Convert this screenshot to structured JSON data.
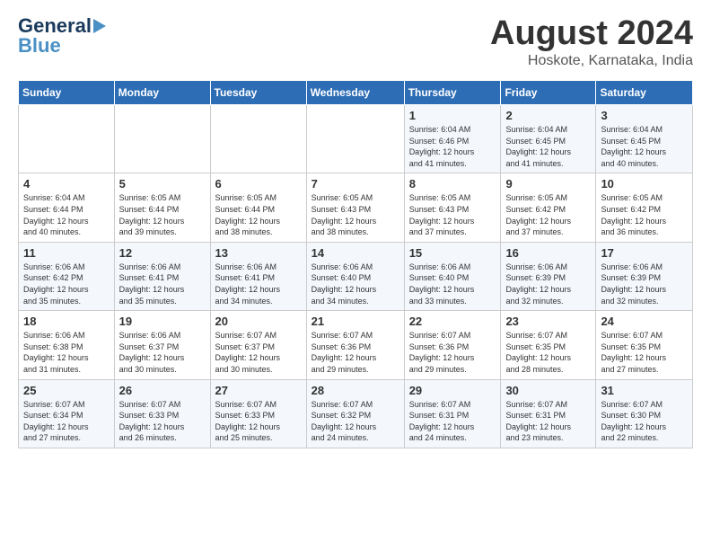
{
  "logo": {
    "line1": "General",
    "line2": "Blue"
  },
  "title": "August 2024",
  "subtitle": "Hoskote, Karnataka, India",
  "headers": [
    "Sunday",
    "Monday",
    "Tuesday",
    "Wednesday",
    "Thursday",
    "Friday",
    "Saturday"
  ],
  "weeks": [
    [
      {
        "day": "",
        "info": ""
      },
      {
        "day": "",
        "info": ""
      },
      {
        "day": "",
        "info": ""
      },
      {
        "day": "",
        "info": ""
      },
      {
        "day": "1",
        "info": "Sunrise: 6:04 AM\nSunset: 6:46 PM\nDaylight: 12 hours\nand 41 minutes."
      },
      {
        "day": "2",
        "info": "Sunrise: 6:04 AM\nSunset: 6:45 PM\nDaylight: 12 hours\nand 41 minutes."
      },
      {
        "day": "3",
        "info": "Sunrise: 6:04 AM\nSunset: 6:45 PM\nDaylight: 12 hours\nand 40 minutes."
      }
    ],
    [
      {
        "day": "4",
        "info": "Sunrise: 6:04 AM\nSunset: 6:44 PM\nDaylight: 12 hours\nand 40 minutes."
      },
      {
        "day": "5",
        "info": "Sunrise: 6:05 AM\nSunset: 6:44 PM\nDaylight: 12 hours\nand 39 minutes."
      },
      {
        "day": "6",
        "info": "Sunrise: 6:05 AM\nSunset: 6:44 PM\nDaylight: 12 hours\nand 38 minutes."
      },
      {
        "day": "7",
        "info": "Sunrise: 6:05 AM\nSunset: 6:43 PM\nDaylight: 12 hours\nand 38 minutes."
      },
      {
        "day": "8",
        "info": "Sunrise: 6:05 AM\nSunset: 6:43 PM\nDaylight: 12 hours\nand 37 minutes."
      },
      {
        "day": "9",
        "info": "Sunrise: 6:05 AM\nSunset: 6:42 PM\nDaylight: 12 hours\nand 37 minutes."
      },
      {
        "day": "10",
        "info": "Sunrise: 6:05 AM\nSunset: 6:42 PM\nDaylight: 12 hours\nand 36 minutes."
      }
    ],
    [
      {
        "day": "11",
        "info": "Sunrise: 6:06 AM\nSunset: 6:42 PM\nDaylight: 12 hours\nand 35 minutes."
      },
      {
        "day": "12",
        "info": "Sunrise: 6:06 AM\nSunset: 6:41 PM\nDaylight: 12 hours\nand 35 minutes."
      },
      {
        "day": "13",
        "info": "Sunrise: 6:06 AM\nSunset: 6:41 PM\nDaylight: 12 hours\nand 34 minutes."
      },
      {
        "day": "14",
        "info": "Sunrise: 6:06 AM\nSunset: 6:40 PM\nDaylight: 12 hours\nand 34 minutes."
      },
      {
        "day": "15",
        "info": "Sunrise: 6:06 AM\nSunset: 6:40 PM\nDaylight: 12 hours\nand 33 minutes."
      },
      {
        "day": "16",
        "info": "Sunrise: 6:06 AM\nSunset: 6:39 PM\nDaylight: 12 hours\nand 32 minutes."
      },
      {
        "day": "17",
        "info": "Sunrise: 6:06 AM\nSunset: 6:39 PM\nDaylight: 12 hours\nand 32 minutes."
      }
    ],
    [
      {
        "day": "18",
        "info": "Sunrise: 6:06 AM\nSunset: 6:38 PM\nDaylight: 12 hours\nand 31 minutes."
      },
      {
        "day": "19",
        "info": "Sunrise: 6:06 AM\nSunset: 6:37 PM\nDaylight: 12 hours\nand 30 minutes."
      },
      {
        "day": "20",
        "info": "Sunrise: 6:07 AM\nSunset: 6:37 PM\nDaylight: 12 hours\nand 30 minutes."
      },
      {
        "day": "21",
        "info": "Sunrise: 6:07 AM\nSunset: 6:36 PM\nDaylight: 12 hours\nand 29 minutes."
      },
      {
        "day": "22",
        "info": "Sunrise: 6:07 AM\nSunset: 6:36 PM\nDaylight: 12 hours\nand 29 minutes."
      },
      {
        "day": "23",
        "info": "Sunrise: 6:07 AM\nSunset: 6:35 PM\nDaylight: 12 hours\nand 28 minutes."
      },
      {
        "day": "24",
        "info": "Sunrise: 6:07 AM\nSunset: 6:35 PM\nDaylight: 12 hours\nand 27 minutes."
      }
    ],
    [
      {
        "day": "25",
        "info": "Sunrise: 6:07 AM\nSunset: 6:34 PM\nDaylight: 12 hours\nand 27 minutes."
      },
      {
        "day": "26",
        "info": "Sunrise: 6:07 AM\nSunset: 6:33 PM\nDaylight: 12 hours\nand 26 minutes."
      },
      {
        "day": "27",
        "info": "Sunrise: 6:07 AM\nSunset: 6:33 PM\nDaylight: 12 hours\nand 25 minutes."
      },
      {
        "day": "28",
        "info": "Sunrise: 6:07 AM\nSunset: 6:32 PM\nDaylight: 12 hours\nand 24 minutes."
      },
      {
        "day": "29",
        "info": "Sunrise: 6:07 AM\nSunset: 6:31 PM\nDaylight: 12 hours\nand 24 minutes."
      },
      {
        "day": "30",
        "info": "Sunrise: 6:07 AM\nSunset: 6:31 PM\nDaylight: 12 hours\nand 23 minutes."
      },
      {
        "day": "31",
        "info": "Sunrise: 6:07 AM\nSunset: 6:30 PM\nDaylight: 12 hours\nand 22 minutes."
      }
    ]
  ]
}
